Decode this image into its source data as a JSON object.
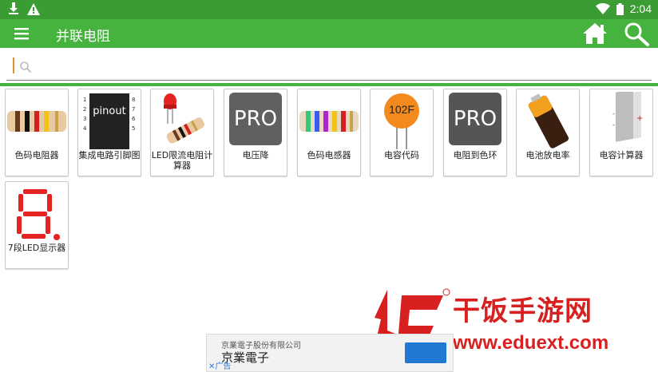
{
  "status_bar": {
    "time": "2:04",
    "left_icons": [
      "download-icon",
      "warning-icon"
    ],
    "right_icons": [
      "wifi-icon",
      "battery-icon"
    ]
  },
  "app_bar": {
    "title": "并联电阻",
    "icons": [
      "menu-icon",
      "home-icon",
      "search-icon"
    ]
  },
  "search": {
    "placeholder": "",
    "value": ""
  },
  "colors": {
    "status_bar": "#3a9c33",
    "app_bar": "#47b33f",
    "accent": "#e09030"
  },
  "tools": [
    {
      "label": "色码电阻器",
      "icon": "resistor-color-code-icon"
    },
    {
      "label": "集成电路引脚图",
      "icon": "ic-pinout-icon",
      "chip_text": "pinout"
    },
    {
      "label": "LED限流电阻计算器",
      "icon": "led-resistor-icon"
    },
    {
      "label": "电压降",
      "icon": "voltage-drop-pro-icon",
      "badge": "PRO"
    },
    {
      "label": "色码电感器",
      "icon": "inductor-color-code-icon"
    },
    {
      "label": "电容代码",
      "icon": "capacitor-code-icon",
      "cap_text": "102F"
    },
    {
      "label": "电阻到色环",
      "icon": "resistor-to-color-pro-icon",
      "badge": "PRO"
    },
    {
      "label": "电池放电率",
      "icon": "battery-discharge-icon"
    },
    {
      "label": "电容计算器",
      "icon": "capacitor-calculator-icon"
    },
    {
      "label": "7段LED显示器",
      "icon": "seven-segment-icon"
    }
  ],
  "watermark": {
    "title": "干饭手游网",
    "url": "www.eduext.com"
  },
  "ad": {
    "company_small": "京業電子股份有限公司",
    "company_large": "京業電子",
    "label": "广告",
    "close": "✕"
  }
}
